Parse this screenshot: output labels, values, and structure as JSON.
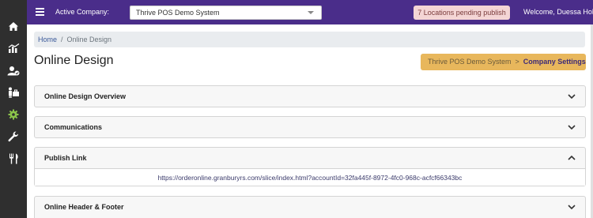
{
  "topbar": {
    "active_company_label": "Active Company:",
    "company_value": "Thrive POS Demo System",
    "pending_badge": "7 Locations pending publish",
    "welcome_text": "Welcome, Duessa Holscher"
  },
  "sidebar": {
    "items": [
      {
        "icon": "home-icon"
      },
      {
        "icon": "reports-icon"
      },
      {
        "icon": "users-icon"
      },
      {
        "icon": "employees-icon"
      },
      {
        "icon": "settings-icon",
        "active": true
      },
      {
        "icon": "tools-icon"
      },
      {
        "icon": "menu-icon"
      }
    ],
    "active_color": "#8bc34a"
  },
  "breadcrumb": {
    "home": "Home",
    "separator": "/",
    "current": "Online Design"
  },
  "page": {
    "title": "Online Design"
  },
  "company_crumb": {
    "company": "Thrive POS Demo System",
    "arrow": ">",
    "settings": "Company Settings"
  },
  "panels": [
    {
      "title": "Online Design Overview",
      "state": "collapsed"
    },
    {
      "title": "Communications",
      "state": "collapsed"
    },
    {
      "title": "Publish Link",
      "state": "expanded",
      "body": "https://orderonline.granburyrs.com/slice/index.html?accountId=32fa445f-8972-4fc0-968c-acfcf66343bc"
    },
    {
      "title": "Online Header & Footer",
      "state": "collapsed"
    }
  ],
  "colors": {
    "topbar": "#4a2d8a",
    "sidebar": "#2f2f2f",
    "badge_bg": "#f4d5d5",
    "crumb_bg": "#e8b75c"
  }
}
